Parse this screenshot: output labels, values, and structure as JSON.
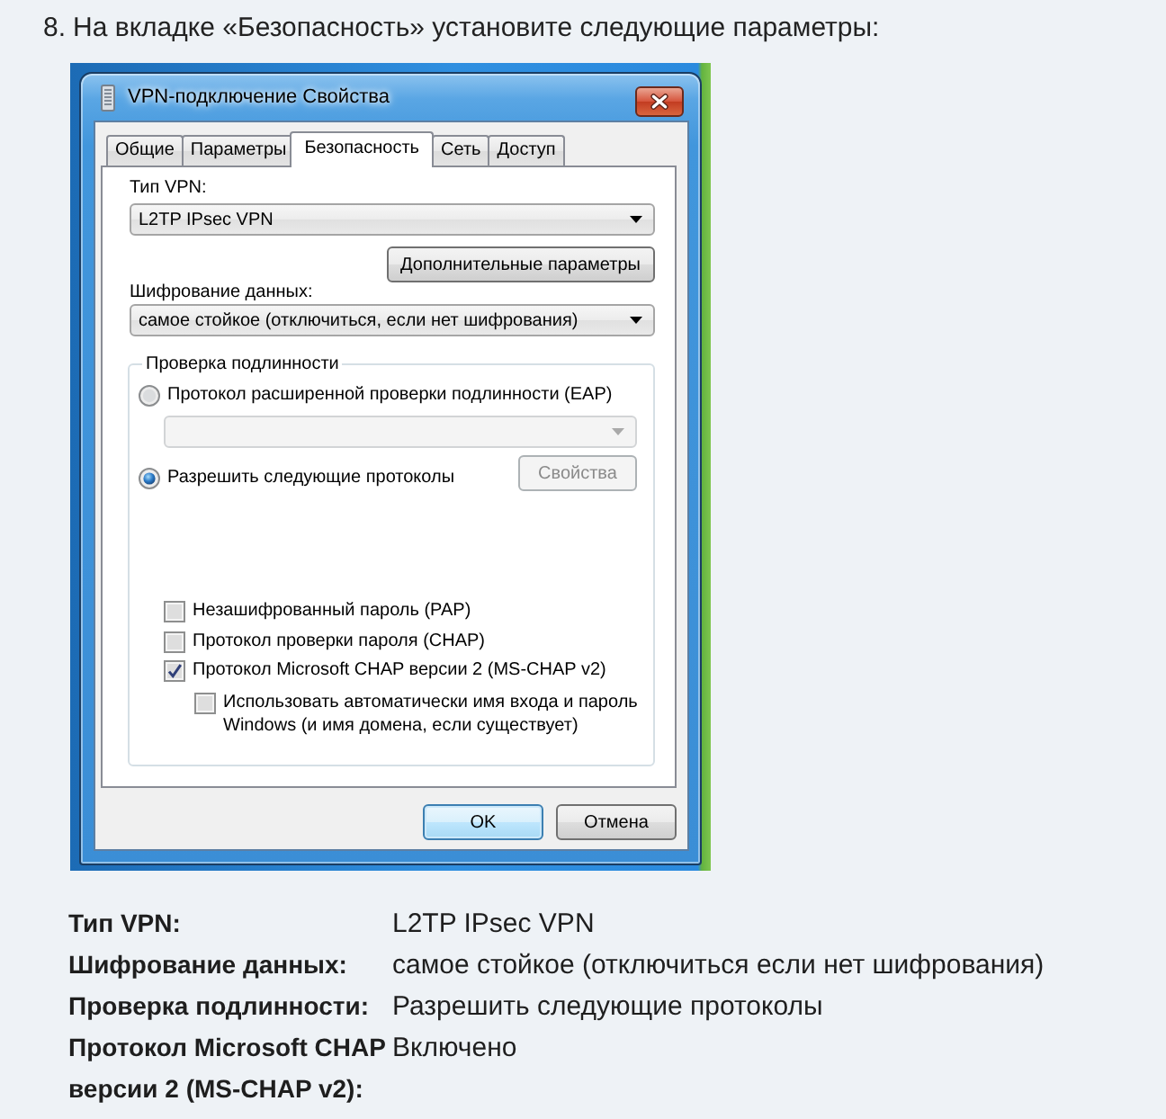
{
  "instruction": {
    "number": "8.",
    "text": "На вкладке «Безопасность» установите следующие параметры:"
  },
  "dialog": {
    "title": "VPN-подключение Свойства",
    "tabs": [
      {
        "label": "Общие",
        "selected": false
      },
      {
        "label": "Параметры",
        "selected": false
      },
      {
        "label": "Безопасность",
        "selected": true
      },
      {
        "label": "Сеть",
        "selected": false
      },
      {
        "label": "Доступ",
        "selected": false
      }
    ],
    "vpn_type": {
      "label": "Тип VPN:",
      "value": "L2TP IPsec VPN"
    },
    "advanced_button": "Дополнительные параметры",
    "encryption": {
      "label": "Шифрование данных:",
      "value": "самое стойкое (отключиться, если нет шифрования)"
    },
    "authentication": {
      "title": "Проверка подлинности",
      "options": [
        {
          "label": "Протокол расширенной проверки подлинности (EAP)",
          "selected": false
        },
        {
          "label": "Разрешить следующие протоколы",
          "selected": true
        }
      ],
      "eap_method": {
        "disabled": true
      },
      "properties_button": {
        "label": "Свойства",
        "disabled": true
      },
      "protocols": [
        {
          "label": "Незашифрованный пароль (PAP)",
          "checked": false
        },
        {
          "label": "Протокол проверки пароля (CHAP)",
          "checked": false
        },
        {
          "label": "Протокол Microsoft CHAP версии 2 (MS-CHAP v2)",
          "checked": true,
          "children": [
            {
              "label": "Использовать автоматически имя входа и пароль Windows (и имя домена, если существует)",
              "checked": false
            }
          ]
        }
      ]
    },
    "buttons": [
      {
        "label": "OK",
        "default": true
      },
      {
        "label": "Отмена",
        "default": false
      }
    ]
  },
  "settings": [
    {
      "label": "Тип VPN:",
      "value": "L2TP IPsec VPN"
    },
    {
      "label": "Шифрование данных:",
      "value": "самое стойкое (отключиться если нет шифрования)"
    },
    {
      "label": "Проверка подлинности:",
      "value": "Разрешить следующие протоколы"
    },
    {
      "label": "Протокол Microsoft CHAP версии 2 (MS-CHAP v2):",
      "value": "Включено"
    }
  ]
}
